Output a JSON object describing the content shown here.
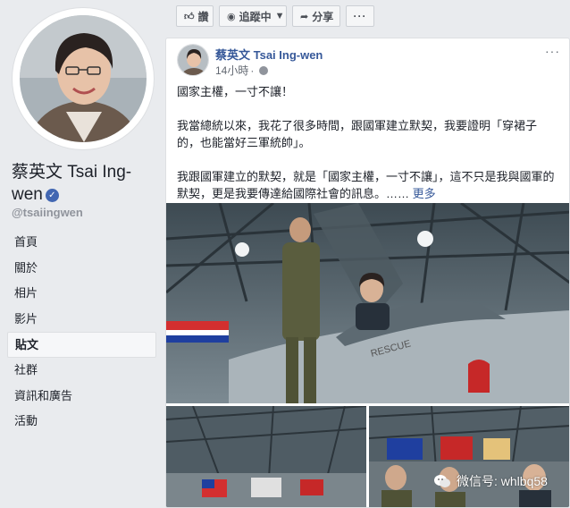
{
  "profile": {
    "name": "蔡英文 Tsai Ing-wen",
    "handle": "@tsaiingwen",
    "verified_icon": "check-icon"
  },
  "nav": {
    "items": [
      {
        "label": "首頁"
      },
      {
        "label": "關於"
      },
      {
        "label": "相片"
      },
      {
        "label": "影片"
      },
      {
        "label": "貼文",
        "active": true
      },
      {
        "label": "社群"
      },
      {
        "label": "資訊和廣告"
      },
      {
        "label": "活動"
      }
    ]
  },
  "actions": {
    "like_label": "讚",
    "follow_label": "追蹤中",
    "share_label": "分享",
    "more_label": "···"
  },
  "post": {
    "author": "蔡英文 Tsai Ing-wen",
    "time": "14小時",
    "options_label": "···",
    "paragraphs": [
      "國家主權，一寸不讓！",
      "我當總統以來，我花了很多時間，跟國軍建立默契，我要證明「穿裙子的，也能當好三軍統帥」。",
      "我跟國軍建立的默契，就是「國家主權，一寸不讓」，這不只是我與國軍的默契，更是我要傳達給國際社會的訊息。……"
    ],
    "see_more": "更多",
    "aircraft_marking": "RESCUE"
  },
  "watermark": {
    "text": "微信号: whlbq58"
  },
  "colors": {
    "link": "#365899",
    "background": "#e9ebee",
    "verified": "#4267b2"
  }
}
